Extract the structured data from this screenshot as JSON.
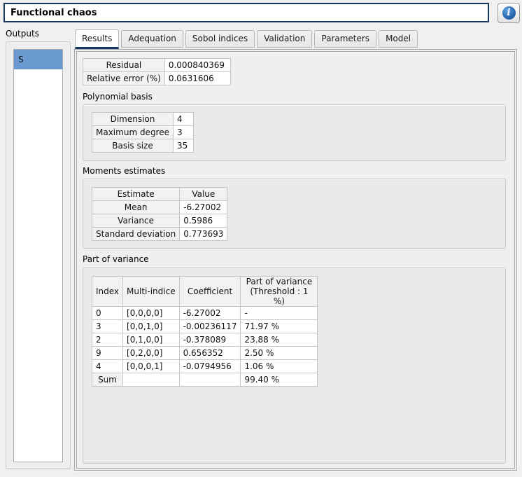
{
  "header": {
    "title": "Functional chaos"
  },
  "icons": {
    "info": "i"
  },
  "sidebar": {
    "label": "Outputs",
    "items": [
      {
        "label": "S",
        "selected": true
      }
    ]
  },
  "tabs": [
    {
      "label": "Results",
      "active": true
    },
    {
      "label": "Adequation"
    },
    {
      "label": "Sobol indices"
    },
    {
      "label": "Validation"
    },
    {
      "label": "Parameters"
    },
    {
      "label": "Model"
    }
  ],
  "results": {
    "summary_table": {
      "rows": [
        {
          "label": "Residual",
          "value": "0.000840369"
        },
        {
          "label": "Relative error (%)",
          "value": "0.0631606"
        }
      ]
    },
    "polynomial_basis": {
      "title": "Polynomial basis",
      "rows": [
        {
          "label": "Dimension",
          "value": "4"
        },
        {
          "label": "Maximum degree",
          "value": "3"
        },
        {
          "label": "Basis size",
          "value": "35"
        }
      ]
    },
    "moments": {
      "title": "Moments estimates",
      "headers": {
        "estimate": "Estimate",
        "value": "Value"
      },
      "rows": [
        {
          "label": "Mean",
          "value": "-6.27002"
        },
        {
          "label": "Variance",
          "value": "0.5986"
        },
        {
          "label": "Standard deviation",
          "value": "0.773693"
        }
      ]
    },
    "part_of_variance": {
      "title": "Part of variance",
      "headers": {
        "index": "Index",
        "multi_indice": "Multi-indice",
        "coefficient": "Coefficient",
        "part": "Part of variance\n(Threshold : 1 %)"
      },
      "rows": [
        {
          "index": "0",
          "multi_indice": "[0,0,0,0]",
          "coefficient": "-6.27002",
          "part": "-"
        },
        {
          "index": "3",
          "multi_indice": "[0,0,1,0]",
          "coefficient": "-0.00236117",
          "part": "71.97 %"
        },
        {
          "index": "2",
          "multi_indice": "[0,1,0,0]",
          "coefficient": "-0.378089",
          "part": "23.88 %"
        },
        {
          "index": "9",
          "multi_indice": "[0,2,0,0]",
          "coefficient": "0.656352",
          "part": "2.50 %"
        },
        {
          "index": "4",
          "multi_indice": "[0,0,0,1]",
          "coefficient": "-0.0794956",
          "part": "1.06 %"
        }
      ],
      "sum_row": {
        "label": "Sum",
        "part": "99.40 %"
      }
    }
  },
  "colors": {
    "accent_navy": "#17395f",
    "selection_blue": "#6999cf",
    "info_blue": "#2a6cb5"
  }
}
